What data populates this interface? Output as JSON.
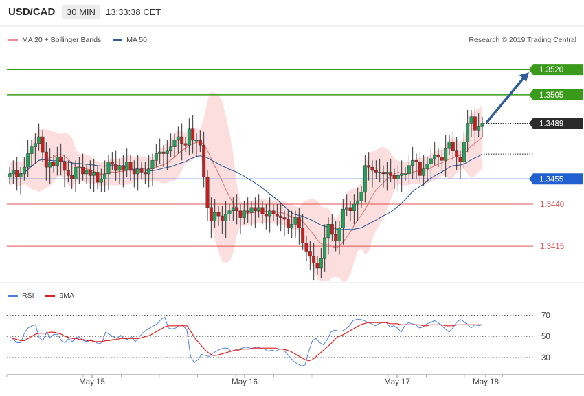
{
  "header": {
    "symbol": "USD/CAD",
    "timeframe": "30 MIN",
    "time": "13:33:38 CET"
  },
  "legend": {
    "ma20": "MA 20 + Bollinger Bands",
    "ma50": "MA 50"
  },
  "credit": "Research © 2019 Trading Central",
  "rsi_legend": {
    "rsi": "RSI",
    "ma9": "9MA"
  },
  "colors": {
    "bg": "#ffffff",
    "candle_up": "#1fa35a",
    "candle_down": "#cc1d1d",
    "ma20": "#e57373",
    "band": "#fbd3d3",
    "ma50": "#2f5d97",
    "resistance": "#3a9a1a",
    "support": "#e05050",
    "pivot": "#2060d0",
    "arrow": "#2f5d97",
    "rsi": "#4d7fe0",
    "rsi_ma": "#e02020"
  },
  "chart_data": [
    {
      "type": "candlestick",
      "x_labels": [
        "May 15",
        "May 16",
        "May 17",
        "May 18"
      ],
      "ylim": [
        1.3393,
        1.3536
      ],
      "current_price": "1.3489",
      "levels": [
        {
          "label": "1.3520",
          "value": 1.352,
          "kind": "resistance"
        },
        {
          "label": "1.3505",
          "value": 1.3505,
          "kind": "resistance"
        },
        {
          "label": "1.3455",
          "value": 1.3455,
          "kind": "pivot"
        },
        {
          "label": "1.3440",
          "value": 1.344,
          "kind": "support"
        },
        {
          "label": "1.3415",
          "value": 1.3415,
          "kind": "support"
        }
      ],
      "closes": [
        1.3458,
        1.346,
        1.3456,
        1.3458,
        1.3462,
        1.347,
        1.3474,
        1.3476,
        1.348,
        1.3471,
        1.3462,
        1.3465,
        1.3463,
        1.3468,
        1.3465,
        1.346,
        1.3457,
        1.3455,
        1.3462,
        1.3462,
        1.3458,
        1.346,
        1.3457,
        1.3459,
        1.3453,
        1.3455,
        1.3458,
        1.3465,
        1.3464,
        1.346,
        1.3463,
        1.346,
        1.3465,
        1.346,
        1.3458,
        1.3461,
        1.3459,
        1.3458,
        1.3461,
        1.3466,
        1.347,
        1.3471,
        1.347,
        1.3472,
        1.3474,
        1.3478,
        1.348,
        1.3476,
        1.3475,
        1.3485,
        1.3478,
        1.3478,
        1.3475,
        1.3456,
        1.3438,
        1.343,
        1.3435,
        1.3433,
        1.343,
        1.3434,
        1.3436,
        1.3438,
        1.3436,
        1.3432,
        1.3436,
        1.3435,
        1.3438,
        1.3436,
        1.3438,
        1.3434,
        1.3433,
        1.3436,
        1.3434,
        1.3433,
        1.3432,
        1.3431,
        1.3426,
        1.3428,
        1.3432,
        1.3426,
        1.3417,
        1.3412,
        1.3409,
        1.3405,
        1.3402,
        1.3408,
        1.342,
        1.3428,
        1.3422,
        1.3418,
        1.3426,
        1.3437,
        1.3438,
        1.3436,
        1.344,
        1.3442,
        1.3447,
        1.3463,
        1.3462,
        1.346,
        1.3459,
        1.3459,
        1.3458,
        1.3459,
        1.3457,
        1.3455,
        1.3457,
        1.3458,
        1.3458,
        1.3463,
        1.3466,
        1.3465,
        1.3457,
        1.3461,
        1.3464,
        1.3467,
        1.3469,
        1.3468,
        1.3466,
        1.3473,
        1.3477,
        1.3472,
        1.3468,
        1.3465,
        1.3477,
        1.3488,
        1.3492,
        1.3484,
        1.3486,
        1.3488
      ]
    },
    {
      "type": "line",
      "title": "RSI",
      "y_ticks": [
        30,
        50,
        70
      ],
      "ylim": [
        17,
        82
      ],
      "series": [
        {
          "name": "RSI",
          "values": [
            46,
            47,
            44,
            44,
            53,
            58,
            60,
            61,
            49,
            46,
            54,
            49,
            52,
            52,
            46,
            44,
            48,
            45,
            49,
            49,
            46,
            45,
            47,
            45,
            43,
            44,
            54,
            52,
            50,
            48,
            51,
            48,
            47,
            50,
            45,
            49,
            53,
            56,
            58,
            60,
            62,
            66,
            68,
            58,
            57,
            58,
            61,
            60,
            56,
            31,
            25,
            28,
            33,
            32,
            31,
            34,
            36,
            38,
            39,
            39,
            36,
            37,
            38,
            39,
            40,
            39,
            39,
            40,
            39,
            38,
            36,
            37,
            36,
            38,
            38,
            34,
            30,
            26,
            24,
            22,
            23,
            36,
            46,
            48,
            44,
            42,
            47,
            54,
            56,
            55,
            55,
            57,
            60,
            65,
            66,
            66,
            65,
            63,
            62,
            60,
            62,
            63,
            63,
            59,
            60,
            58,
            54,
            60,
            63,
            62,
            61,
            58,
            59,
            62,
            63,
            65,
            63,
            60,
            57,
            54,
            58,
            63,
            66,
            64,
            61,
            58,
            61,
            60,
            61
          ]
        },
        {
          "name": "9MA",
          "values": [
            49,
            48,
            47,
            46,
            46,
            48,
            50,
            52,
            53,
            53,
            53,
            54,
            54,
            53,
            52,
            50,
            49,
            48,
            48,
            47,
            47,
            46,
            46,
            45,
            45,
            45,
            46,
            46,
            47,
            47,
            48,
            48,
            48,
            48,
            48,
            48,
            49,
            50,
            51,
            53,
            55,
            57,
            59,
            60,
            60,
            60,
            60,
            60,
            60,
            55,
            49,
            45,
            41,
            37,
            34,
            32,
            32,
            33,
            34,
            35,
            36,
            37,
            37,
            38,
            38,
            38,
            39,
            39,
            39,
            39,
            39,
            39,
            39,
            38,
            38,
            37,
            36,
            34,
            32,
            30,
            28,
            27,
            28,
            31,
            34,
            37,
            40,
            43,
            47,
            50,
            51,
            53,
            55,
            57,
            59,
            61,
            62,
            63,
            63,
            63,
            63,
            63,
            63,
            62,
            62,
            62,
            61,
            61,
            61,
            61,
            61,
            61,
            60,
            60,
            61,
            61,
            61,
            61,
            60,
            60,
            60,
            61,
            61,
            61,
            61,
            61,
            61,
            61,
            61
          ]
        }
      ]
    }
  ]
}
